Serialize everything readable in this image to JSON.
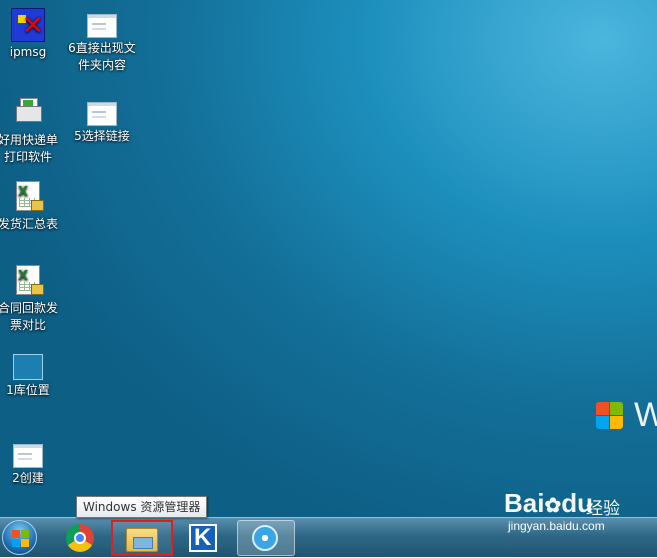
{
  "desktop": {
    "icons": [
      {
        "label": "ipmsg",
        "icon": "ipmsg-app-icon"
      },
      {
        "label": "6直接出现文件夹内容",
        "icon": "window-thumbnail-icon"
      },
      {
        "label": "好用快递单打印软件",
        "icon": "printer-app-icon"
      },
      {
        "label": "5选择链接",
        "icon": "window-thumbnail-icon"
      },
      {
        "label": "发货汇总表",
        "icon": "excel-shortcut-icon"
      },
      {
        "label": "合同回款发票对比",
        "icon": "excel-shortcut-icon"
      },
      {
        "label": "1库位置",
        "icon": "location-image-icon"
      },
      {
        "label": "2创建",
        "icon": "window-thumbnail-icon"
      }
    ],
    "brand_watermark": "W"
  },
  "taskbar": {
    "items": [
      {
        "name": "Google Chrome",
        "icon": "chrome-icon"
      },
      {
        "name": "Windows 资源管理器",
        "icon": "folder-explorer-icon",
        "highlighted": true
      },
      {
        "name": "K3",
        "icon": "k-app-icon"
      },
      {
        "name": "Safari",
        "icon": "compass-icon",
        "active": true
      }
    ],
    "tooltip": "Windows 资源管理器"
  },
  "watermark": {
    "logo": "Bai",
    "logo2": "du",
    "cn": "经验",
    "url": "jingyan.baidu.com"
  },
  "colors": {
    "desktop": "#1d8fbd",
    "taskbar": "#2e6886",
    "highlight_border": "#e02020"
  }
}
